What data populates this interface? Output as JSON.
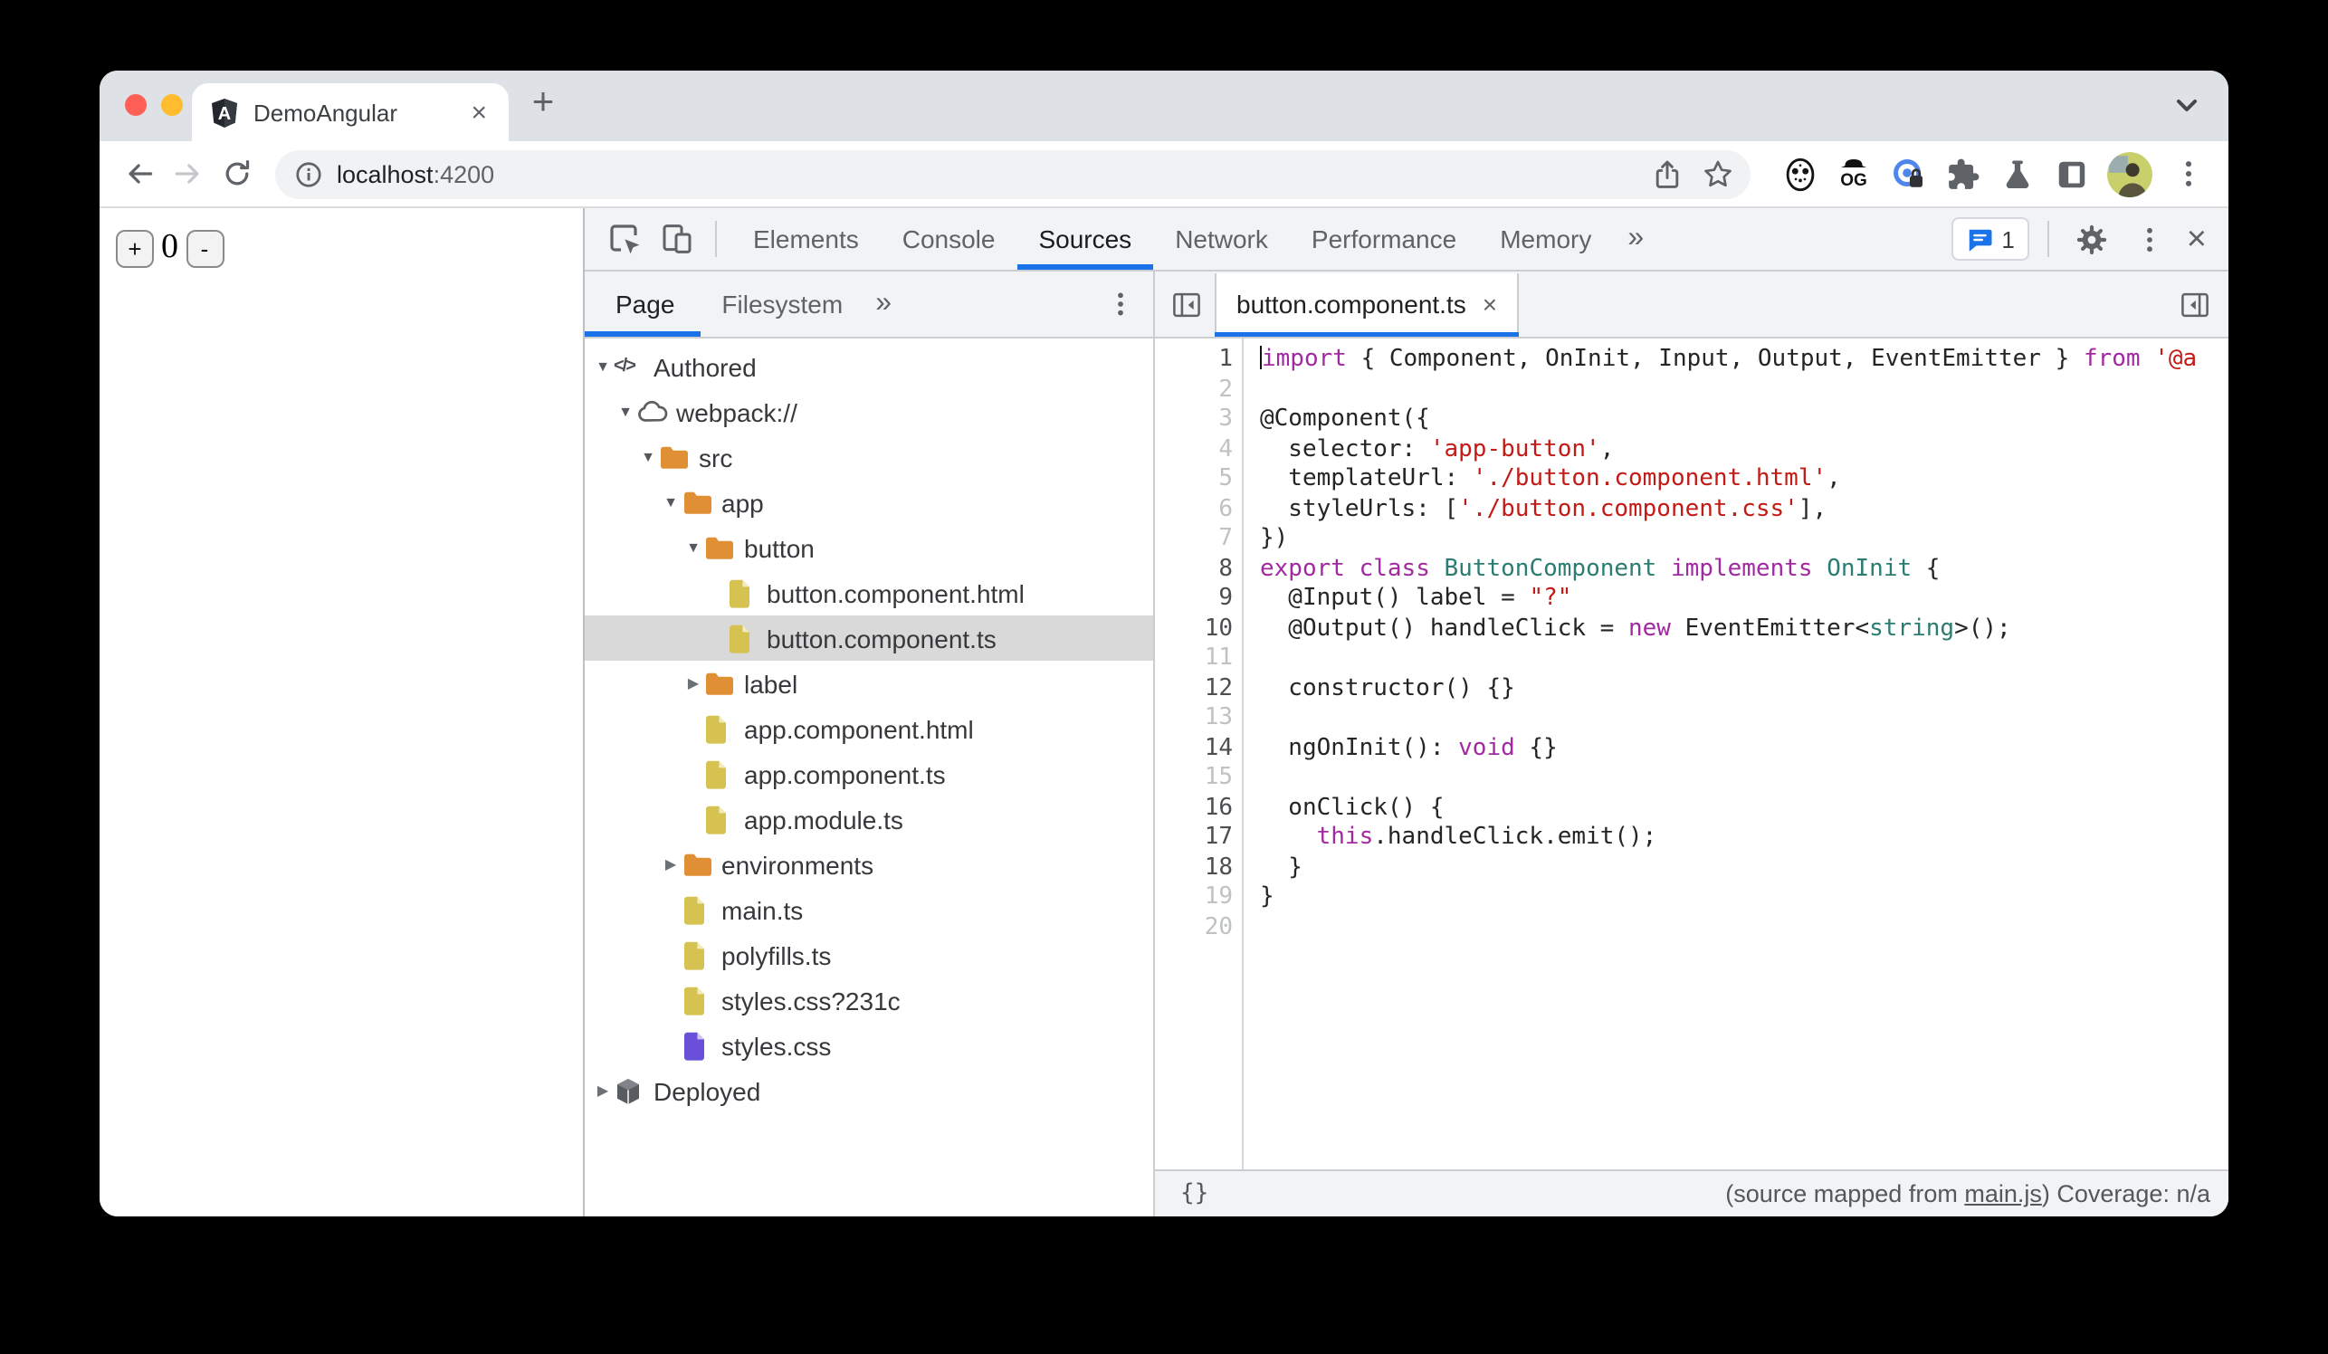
{
  "browser_tab": {
    "title": "DemoAngular",
    "close_label": "×",
    "new_tab_label": "+"
  },
  "toolbar": {
    "url_host": "localhost",
    "url_port": ":4200"
  },
  "page": {
    "increment_label": "+",
    "counter_value": "0",
    "decrement_label": "-"
  },
  "devtools": {
    "tabs": [
      "Elements",
      "Console",
      "Sources",
      "Network",
      "Performance",
      "Memory"
    ],
    "active_tab": "Sources",
    "more_tabs_label": "»",
    "issues_count": "1",
    "close_label": "×",
    "navigator": {
      "tabs": [
        "Page",
        "Filesystem"
      ],
      "active_tab": "Page",
      "more_label": "»",
      "tree": [
        {
          "label": "Authored",
          "icon": "code",
          "level": 0,
          "caret": "open"
        },
        {
          "label": "webpack://",
          "icon": "cloud",
          "level": 1,
          "caret": "open"
        },
        {
          "label": "src",
          "icon": "folder",
          "level": 2,
          "caret": "open"
        },
        {
          "label": "app",
          "icon": "folder",
          "level": 3,
          "caret": "open"
        },
        {
          "label": "button",
          "icon": "folder",
          "level": 4,
          "caret": "open"
        },
        {
          "label": "button.component.html",
          "icon": "file-yellow",
          "level": 5,
          "caret": "none"
        },
        {
          "label": "button.component.ts",
          "icon": "file-yellow",
          "level": 5,
          "caret": "none",
          "selected": true
        },
        {
          "label": "label",
          "icon": "folder",
          "level": 4,
          "caret": "closed"
        },
        {
          "label": "app.component.html",
          "icon": "file-yellow",
          "level": 4,
          "caret": "none"
        },
        {
          "label": "app.component.ts",
          "icon": "file-yellow",
          "level": 4,
          "caret": "none"
        },
        {
          "label": "app.module.ts",
          "icon": "file-yellow",
          "level": 4,
          "caret": "none"
        },
        {
          "label": "environments",
          "icon": "folder",
          "level": 3,
          "caret": "closed"
        },
        {
          "label": "main.ts",
          "icon": "file-yellow",
          "level": 3,
          "caret": "none"
        },
        {
          "label": "polyfills.ts",
          "icon": "file-yellow",
          "level": 3,
          "caret": "none"
        },
        {
          "label": "styles.css?231c",
          "icon": "file-yellow",
          "level": 3,
          "caret": "none"
        },
        {
          "label": "styles.css",
          "icon": "file-purple",
          "level": 3,
          "caret": "none"
        },
        {
          "label": "Deployed",
          "icon": "cube",
          "level": 0,
          "caret": "closed"
        }
      ]
    },
    "editor": {
      "tab_title": "button.component.ts",
      "tab_close_label": "×",
      "status_left": "{}",
      "status_mapped_prefix": "(source mapped from ",
      "status_mapped_link": "main.js",
      "status_mapped_suffix": ")",
      "status_coverage": " Coverage: n/a",
      "lines": [
        {
          "n": 1,
          "dim": false,
          "cursor": true,
          "segs": [
            [
              "k",
              "import"
            ],
            [
              "p",
              " { Component, OnInit, Input, Output, EventEmitter } "
            ],
            [
              "k",
              "from"
            ],
            [
              "p",
              " "
            ],
            [
              "s",
              "'@a"
            ]
          ]
        },
        {
          "n": 2,
          "dim": true,
          "segs": []
        },
        {
          "n": 3,
          "dim": true,
          "segs": [
            [
              "p",
              "@Component({"
            ]
          ]
        },
        {
          "n": 4,
          "dim": true,
          "segs": [
            [
              "p",
              "  selector: "
            ],
            [
              "s",
              "'app-button'"
            ],
            [
              "p",
              ","
            ]
          ]
        },
        {
          "n": 5,
          "dim": true,
          "segs": [
            [
              "p",
              "  templateUrl: "
            ],
            [
              "s",
              "'./button.component.html'"
            ],
            [
              "p",
              ","
            ]
          ]
        },
        {
          "n": 6,
          "dim": true,
          "segs": [
            [
              "p",
              "  styleUrls: ["
            ],
            [
              "s",
              "'./button.component.css'"
            ],
            [
              "p",
              "],"
            ]
          ]
        },
        {
          "n": 7,
          "dim": true,
          "segs": [
            [
              "p",
              "})"
            ]
          ]
        },
        {
          "n": 8,
          "dim": false,
          "segs": [
            [
              "k",
              "export"
            ],
            [
              "p",
              " "
            ],
            [
              "k",
              "class"
            ],
            [
              "p",
              " "
            ],
            [
              "t",
              "ButtonComponent"
            ],
            [
              "p",
              " "
            ],
            [
              "k",
              "implements"
            ],
            [
              "p",
              " "
            ],
            [
              "t",
              "OnInit"
            ],
            [
              "p",
              " {"
            ]
          ]
        },
        {
          "n": 9,
          "dim": false,
          "segs": [
            [
              "p",
              "  @Input() label = "
            ],
            [
              "s",
              "\"?\""
            ]
          ]
        },
        {
          "n": 10,
          "dim": false,
          "segs": [
            [
              "p",
              "  @Output() handleClick = "
            ],
            [
              "k",
              "new"
            ],
            [
              "p",
              " EventEmitter<"
            ],
            [
              "t",
              "string"
            ],
            [
              "p",
              ">();"
            ]
          ]
        },
        {
          "n": 11,
          "dim": true,
          "segs": []
        },
        {
          "n": 12,
          "dim": false,
          "segs": [
            [
              "p",
              "  constructor() {}"
            ]
          ]
        },
        {
          "n": 13,
          "dim": true,
          "segs": []
        },
        {
          "n": 14,
          "dim": false,
          "segs": [
            [
              "p",
              "  ngOnInit(): "
            ],
            [
              "k",
              "void"
            ],
            [
              "p",
              " {}"
            ]
          ]
        },
        {
          "n": 15,
          "dim": true,
          "segs": []
        },
        {
          "n": 16,
          "dim": false,
          "segs": [
            [
              "p",
              "  onClick() {"
            ]
          ]
        },
        {
          "n": 17,
          "dim": false,
          "segs": [
            [
              "p",
              "    "
            ],
            [
              "k",
              "this"
            ],
            [
              "p",
              ".handleClick.emit();"
            ]
          ]
        },
        {
          "n": 18,
          "dim": false,
          "segs": [
            [
              "p",
              "  }"
            ]
          ]
        },
        {
          "n": 19,
          "dim": true,
          "segs": [
            [
              "p",
              "}"
            ]
          ]
        },
        {
          "n": 20,
          "dim": true,
          "segs": []
        }
      ]
    }
  }
}
